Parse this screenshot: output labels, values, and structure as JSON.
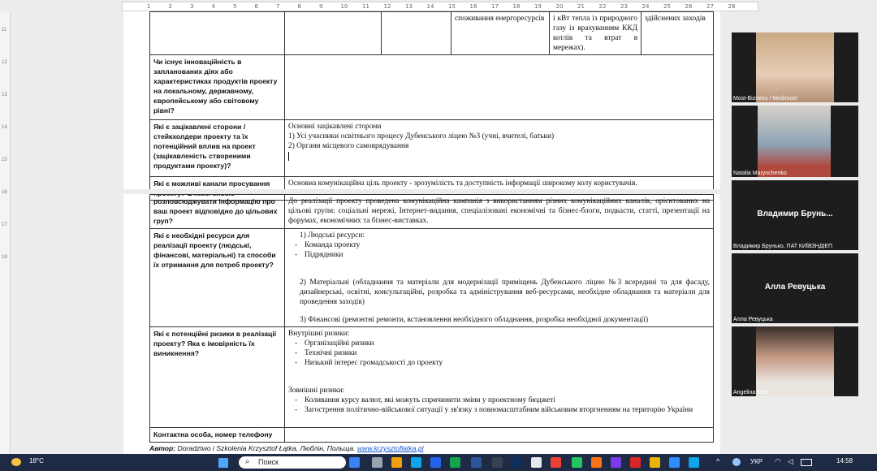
{
  "ruler": {
    "ticks": [
      "1",
      "2",
      "3",
      "4",
      "5",
      "6",
      "7",
      "8",
      "9",
      "10",
      "11",
      "12",
      "13",
      "14",
      "15",
      "16",
      "17",
      "18",
      "19",
      "20",
      "21",
      "22",
      "23",
      "24",
      "25",
      "26",
      "27",
      "28"
    ]
  },
  "table_top": {
    "cell_b": "споживання енергоресурсів",
    "cell_c": "і кВт тепла із природного газу із врахуванням ККД котлів та втрат в мережах).",
    "cell_d": "здійснених заходів"
  },
  "rows": [
    {
      "q": "Чи існує інноваційність в запланованих діях або характеристиках продуктів проекту на локальному, державному, європейському або світовому рівні?",
      "a_lines": []
    },
    {
      "q": "Які є зацікавлені сторони / стейкхолдери проекту та їх потенційний вплив на проект (зацікавленість створеними продуктами проекту)?",
      "a_lines": [
        "Основні зацікавлені сторони",
        "1) Усі учасники освітнього процесу Дубенського ліцею №3 (учні, вчителі, батьки)",
        "2) Органи місцевого самоврядування"
      ]
    },
    {
      "q": "Які є можливі канали просування проекту? В який спосіб",
      "a_lines": [
        "Основна комунікаційна ціль проекту - зрозумілість та доступність інформації широкому колу користувачів."
      ]
    }
  ],
  "rows2": [
    {
      "q": "розповсюджувати інформацію про ваш проект відповідно до цільових груп?",
      "a": "До реалізації проекту проведена комунікаційна кампанія з використанням різних комунікаційних каналів, орієнтованих на цільові групи: соціальні мережі, Інтернет-видання, спеціалізовані економічні та бізнес-блоги, подкасти, статті, презентації на форумах, економічних та бізнес-виставках."
    },
    {
      "q": "Які є необхідні ресурси для реалізації проекту (людські, фінансові, матеріальні) та способи їх отримання для потреб проекту?",
      "a_head": "1)   Людські ресурси:",
      "a_items": [
        "Команда проекту",
        "Підрядники"
      ],
      "a_p2": "2) Матеріальні (обладнання та матеріали для модернізації приміщень Дубенського ліцею №3 всередині та для фасаду, дизайнерські, освітні, консультаційні, розробка та адміністрування веб-ресурсами, необхідне обладнання та матеріали для проведення заходів)",
      "a_p3": "3) Фінансові (ремонтні ремонти, встановлення необхідного обладнання, розробка необхідної документації)"
    },
    {
      "q": "Які є потенційні ризики в реалізації проекту? Яка є імовірність їх виникнення?",
      "a_head": "Внутрішні ризики:",
      "a_items": [
        "Організаційні ризики",
        "Технічні ризики",
        "Низький інтерес громадськості до проекту"
      ],
      "a_head2": "Зовнішні ризики:",
      "a_items2": [
        "Коливання курсу валют, які можуть спричинити зміни у проектному бюджеті",
        "Загострення політично-військової ситуації у зв'язку з повномасштабним військовим вторгненням на територію України"
      ]
    },
    {
      "q": "Контактна особа, номер телефону",
      "a": ""
    }
  ],
  "author": {
    "label": "Автор:",
    "text": "Doradztwo i Szkolenia Krzysztof Łątka, Люблін, Польща.",
    "link": "www.krzysztoflatka.pl"
  },
  "participants": [
    {
      "name": "Most-Biznesu / Medimost",
      "big": ""
    },
    {
      "name": "Natalia Marynchenko",
      "big": ""
    },
    {
      "name": "Владимир Брунько, ПАТ КИЇВЗНДІЕП",
      "big": "Владимир Брунь..."
    },
    {
      "name": "Алла Ревуцька",
      "big": "Алла Ревуцька"
    },
    {
      "name": "Angelina Rad",
      "big": ""
    }
  ],
  "taskbar": {
    "temp": "18°C",
    "search": "Поиск",
    "lang": "УКР",
    "time": "14:58"
  }
}
